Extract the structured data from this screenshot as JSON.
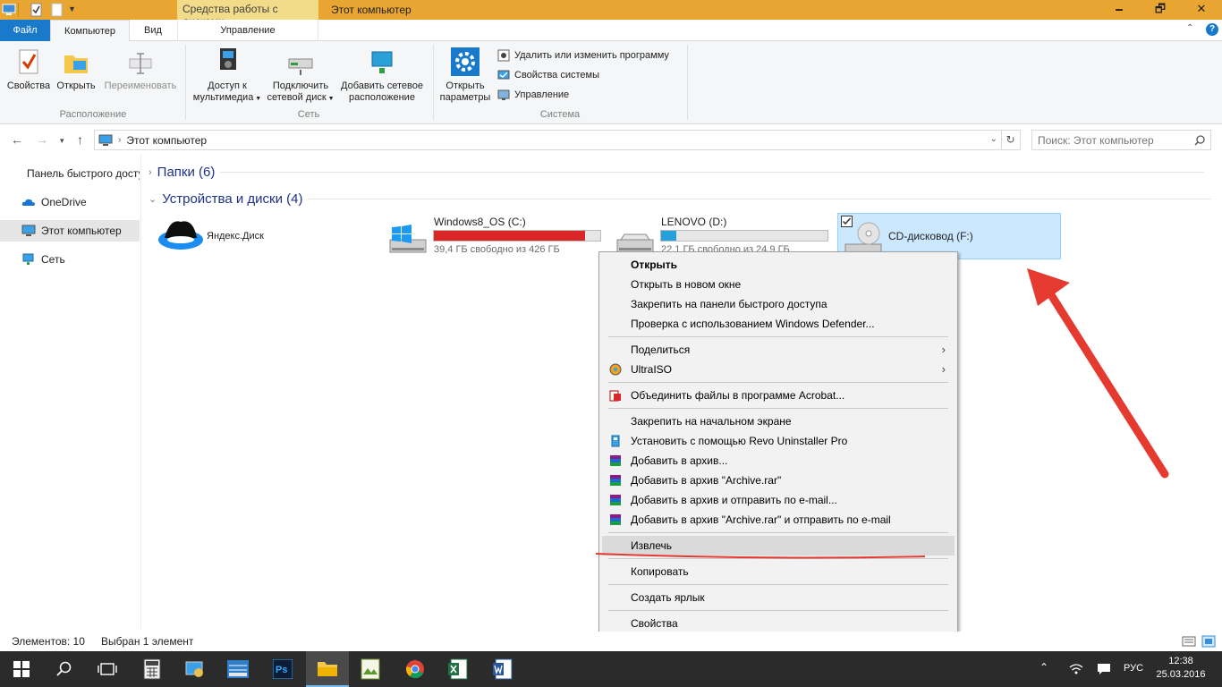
{
  "window": {
    "context_tab_title": "Средства работы с дисками",
    "title": "Этот компьютер",
    "minimize": "🗕",
    "maximize": "🗗",
    "close": "✕"
  },
  "ribbon_tabs": {
    "file": "Файл",
    "computer": "Компьютер",
    "view": "Вид",
    "manage": "Управление"
  },
  "ribbon": {
    "location": {
      "label": "Расположение",
      "properties": "Свойства",
      "open": "Открыть",
      "rename": "Переименовать"
    },
    "network": {
      "label": "Сеть",
      "media_1": "Доступ к",
      "media_2": "мультимедиа",
      "map_1": "Подключить",
      "map_2": "сетевой диск",
      "add_1": "Добавить сетевое",
      "add_2": "расположение"
    },
    "system": {
      "label": "Система",
      "settings_1": "Открыть",
      "settings_2": "параметры",
      "uninstall": "Удалить или изменить программу",
      "sysprops": "Свойства системы",
      "manage": "Управление"
    }
  },
  "address": {
    "path": "Этот компьютер",
    "search_placeholder": "Поиск: Этот компьютер"
  },
  "sidebar": {
    "items": [
      {
        "label": "Панель быстрого доступа"
      },
      {
        "label": "OneDrive"
      },
      {
        "label": "Этот компьютер"
      },
      {
        "label": "Сеть"
      }
    ]
  },
  "main": {
    "folders_header": "Папки (6)",
    "devices_header": "Устройства и диски (4)",
    "drives": [
      {
        "name": "Яндекс.Диск"
      },
      {
        "name": "Windows8_OS (C:)",
        "free": "39,4 ГБ свободно из 426 ГБ",
        "used_fraction": 0.91,
        "bar_color": "#da2626"
      },
      {
        "name": "LENOVO (D:)",
        "free": "22,1 ГБ свободно из 24,9 ГБ",
        "used_fraction": 0.09,
        "bar_color": "#26a0da"
      },
      {
        "name": "CD-дисковод (F:)"
      }
    ]
  },
  "context_menu": {
    "items": [
      "Открыть",
      "Открыть в новом окне",
      "Закрепить на панели быстрого доступа",
      "Проверка с использованием Windows Defender...",
      "Поделиться",
      "UltraISO",
      "Объединить файлы в программе Acrobat...",
      "Закрепить на начальном экране",
      "Установить с помощью Revo Uninstaller Pro",
      "Добавить в архив...",
      "Добавить в архив \"Archive.rar\"",
      "Добавить в архив и отправить по e-mail...",
      "Добавить в архив \"Archive.rar\" и отправить по e-mail",
      "Извлечь",
      "Копировать",
      "Создать ярлык",
      "Свойства"
    ]
  },
  "statusbar": {
    "count": "Элементов: 10",
    "selected": "Выбран 1 элемент"
  },
  "taskbar": {
    "lang": "РУС",
    "time": "12:38",
    "date": "25.03.2016"
  },
  "colors": {
    "titlebar": "#e8a531",
    "accent": "#1979ca",
    "selection": "#cce8ff",
    "annotation": "#e53a2f"
  }
}
